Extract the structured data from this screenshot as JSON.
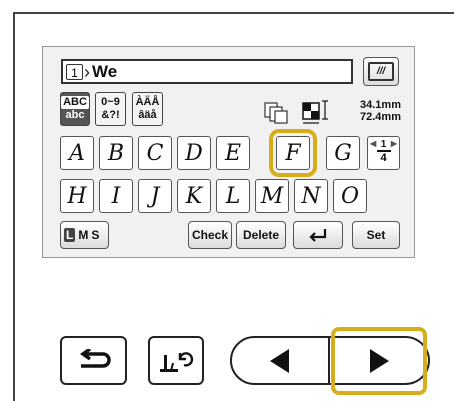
{
  "text_field": {
    "slot_number": "1",
    "value": "We"
  },
  "toolbar": {
    "abc_label_top": "ABC",
    "abc_label_bottom": "abc",
    "num_label_top": "0~9",
    "num_label_bottom": "&?!",
    "accent_label_top": "ÀÄÅ",
    "accent_label_bottom": "âäå",
    "frame_icon": "embroidery-frame-icon"
  },
  "size": {
    "height": "34.1mm",
    "width": "72.4mm"
  },
  "keys": [
    "A",
    "B",
    "C",
    "D",
    "E",
    "F",
    "G",
    "H",
    "I",
    "J",
    "K",
    "L",
    "M",
    "N",
    "O"
  ],
  "selected_key": "F",
  "pager": {
    "current": "1",
    "total": "4"
  },
  "bottom": {
    "size_l": "L",
    "size_m": "M",
    "size_s": "S",
    "check": "Check",
    "delete": "Delete",
    "set": "Set"
  },
  "nav_icons": [
    "back-arrow-icon",
    "presser-foot-rotate-icon",
    "previous-icon",
    "next-icon"
  ],
  "colors": {
    "highlight": "#d8ad1a"
  }
}
